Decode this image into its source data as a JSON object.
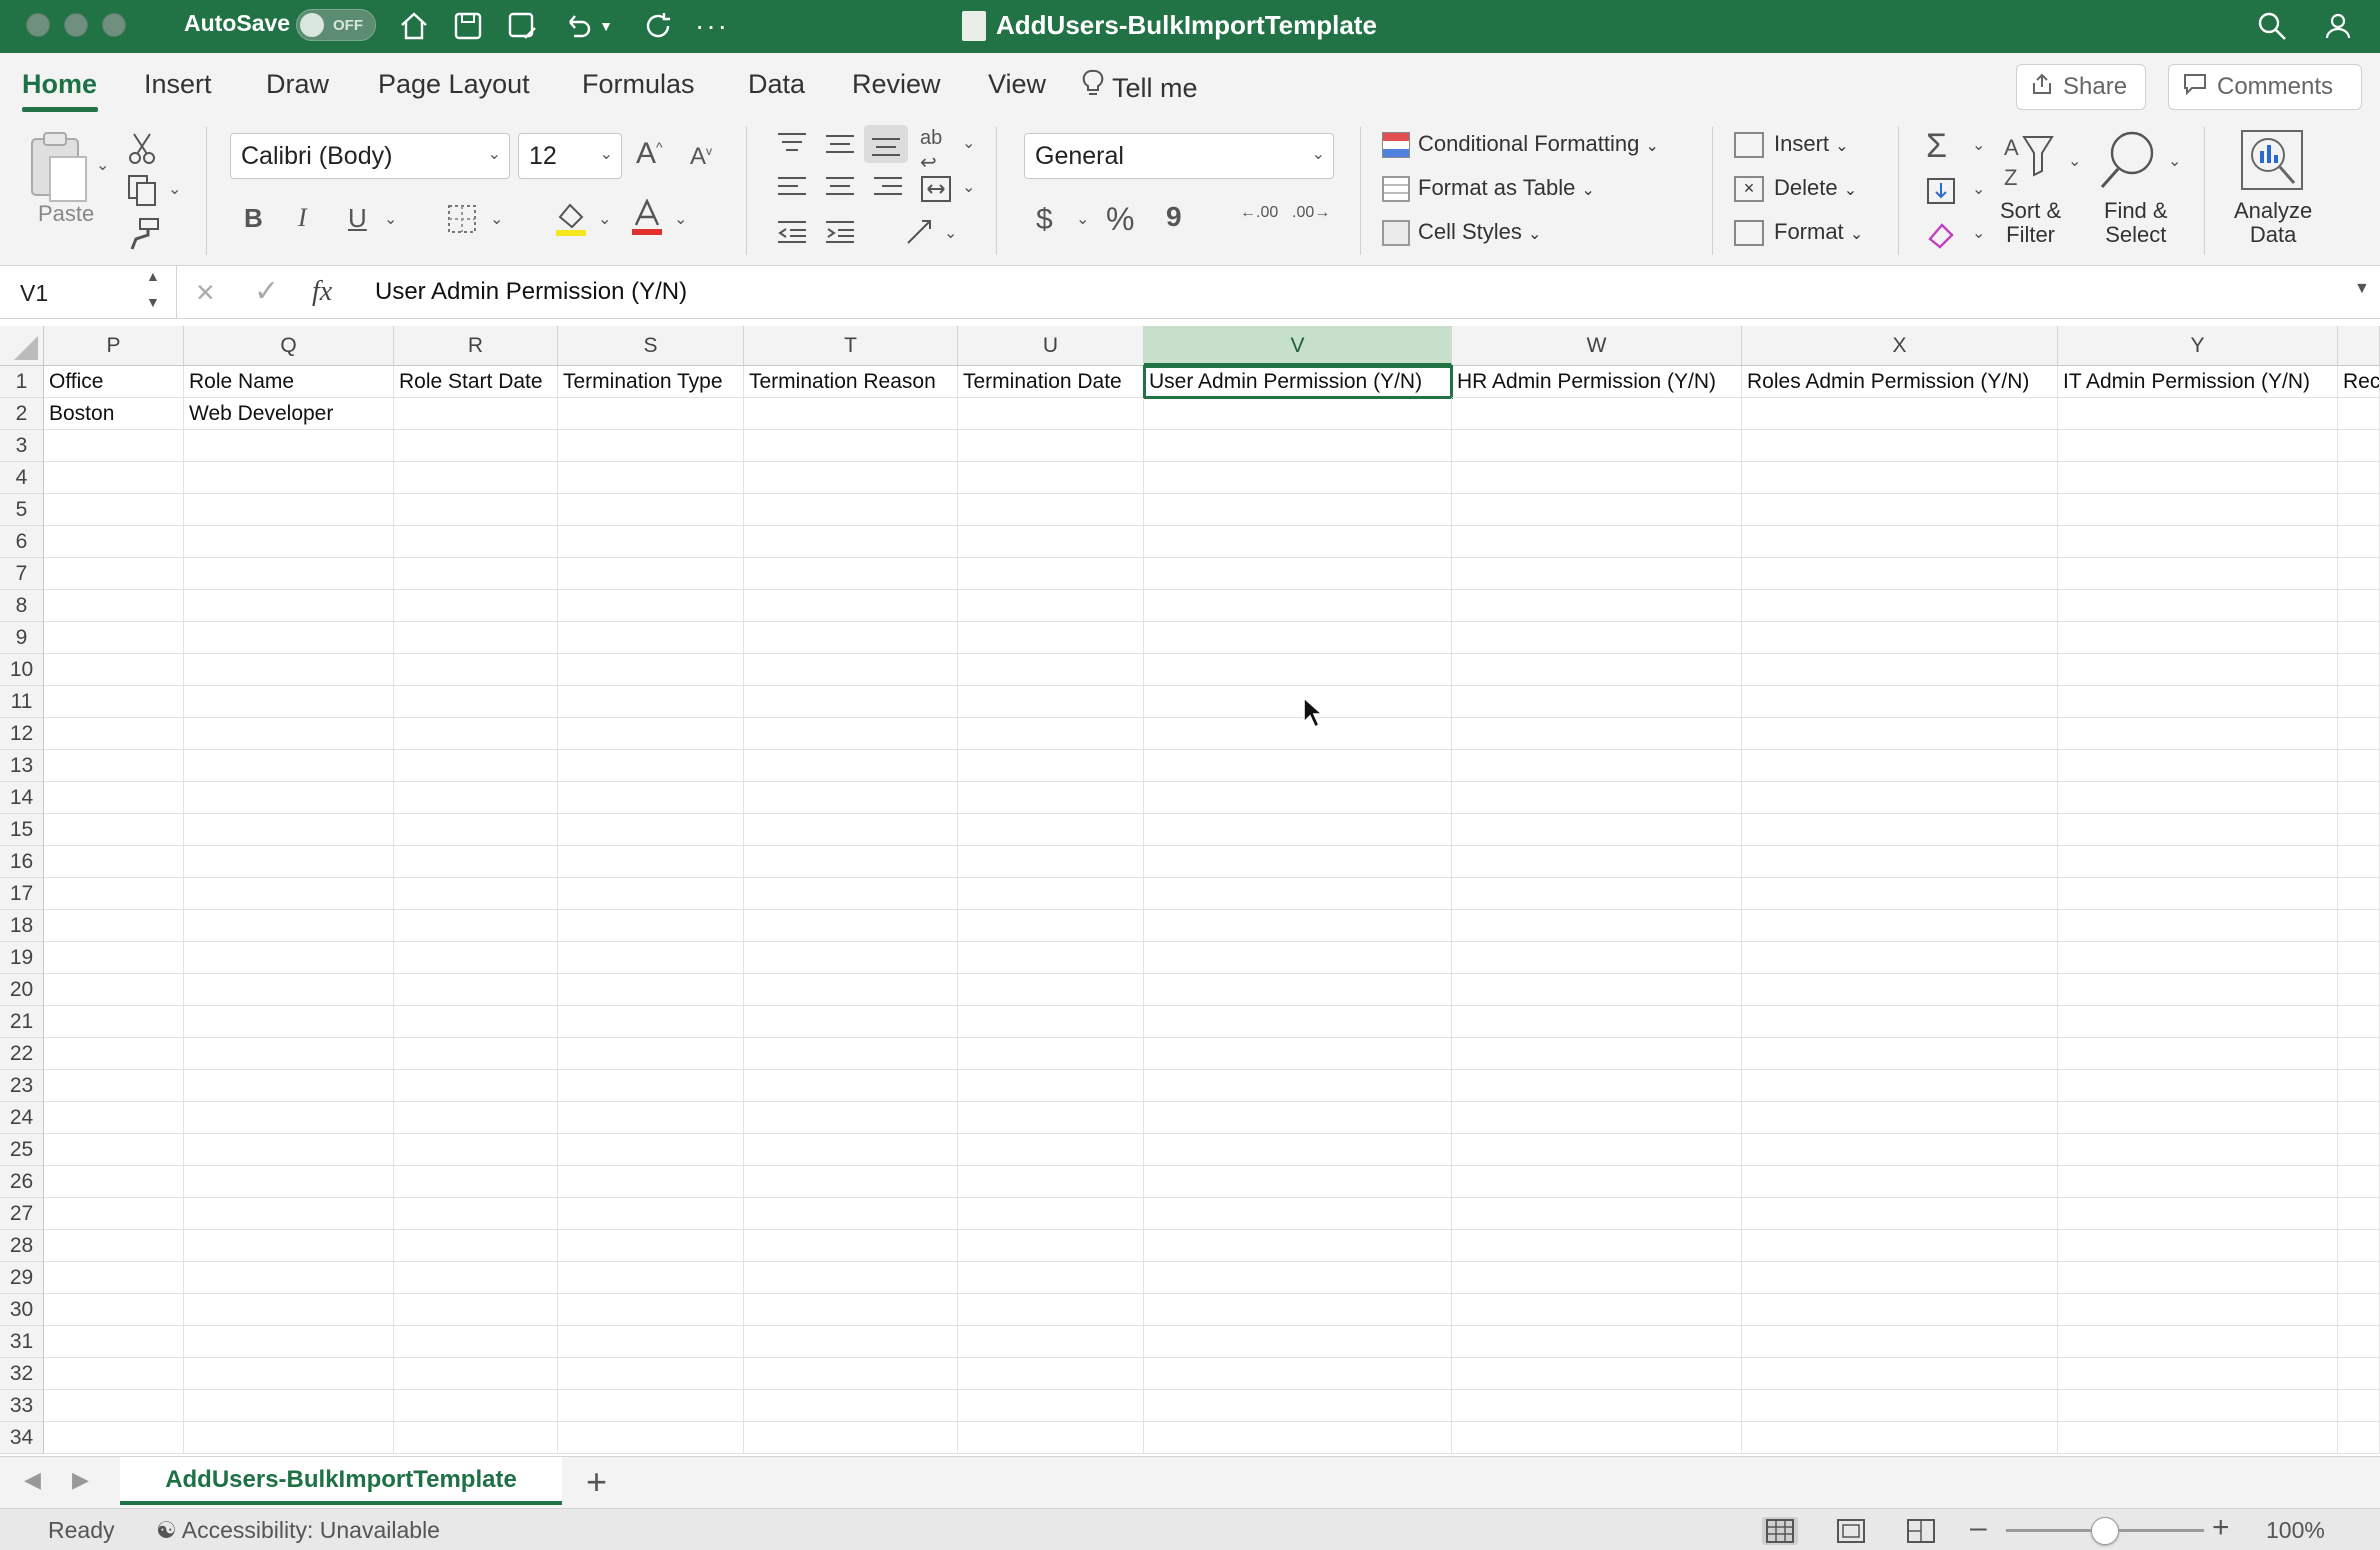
{
  "titlebar": {
    "autosave_label": "AutoSave",
    "autosave_state": "OFF",
    "document_title": "AddUsers-BulkImportTemplate",
    "icons": [
      "home-icon",
      "save-icon",
      "save-as-icon",
      "undo-icon",
      "redo-icon",
      "more-icon",
      "search-icon",
      "account-icon"
    ]
  },
  "ribbon_tabs": [
    "Home",
    "Insert",
    "Draw",
    "Page Layout",
    "Formulas",
    "Data",
    "Review",
    "View"
  ],
  "tell_me": "Tell me",
  "share_label": "Share",
  "comments_label": "Comments",
  "clipboard": {
    "paste_label": "Paste"
  },
  "font": {
    "family": "Calibri (Body)",
    "size": "12",
    "bold": "B",
    "italic": "I",
    "underline": "U",
    "font_color_letter": "A",
    "highlight_color": "#f5e61e",
    "font_color": "#e03030"
  },
  "number": {
    "format": "General",
    "currency": "$",
    "percent": "%",
    "comma": "9",
    "increase_decimal": ".00",
    "decrease_decimal": ".00"
  },
  "styles": {
    "conditional_formatting": "Conditional Formatting",
    "format_as_table": "Format as Table",
    "cell_styles": "Cell Styles"
  },
  "cells": {
    "insert": "Insert",
    "delete": "Delete",
    "format": "Format"
  },
  "editing": {
    "sort_filter": "Sort &\nFilter",
    "find_select": "Find &\nSelect",
    "analyze_data": "Analyze\nData"
  },
  "formula_bar": {
    "name_box": "V1",
    "fx": "fx",
    "content": "User Admin Permission (Y/N)"
  },
  "grid": {
    "columns": [
      "P",
      "Q",
      "R",
      "S",
      "T",
      "U",
      "V",
      "W",
      "X",
      "Y"
    ],
    "selected_column": "V",
    "rows": [
      [
        "Office",
        "Role Name",
        "Role Start Date",
        "Termination Type",
        "Termination Reason",
        "Termination Date",
        "User Admin Permission (Y/N)",
        "HR Admin Permission (Y/N)",
        "Roles Admin Permission (Y/N)",
        "IT Admin Permission (Y/N)",
        "Rec"
      ],
      [
        "Boston",
        "Web Developer",
        "",
        "",
        "",
        "",
        "",
        "",
        "",
        "",
        ""
      ]
    ],
    "row_count": 34
  },
  "sheet_tab": "AddUsers-BulkImportTemplate",
  "status": {
    "ready": "Ready",
    "accessibility": "Accessibility: Unavailable",
    "zoom": "100%",
    "zoom_level": 0.5
  },
  "colors": {
    "accent": "#217346",
    "title_bar": "#217346"
  }
}
